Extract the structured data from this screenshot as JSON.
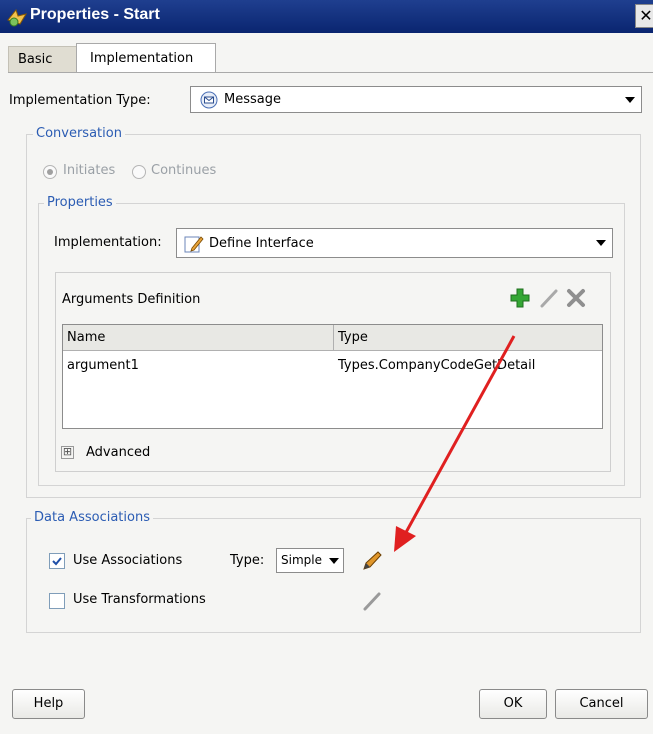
{
  "window": {
    "title": "Properties - Start",
    "close_glyph": "✕"
  },
  "tabs": [
    {
      "label": "Basic",
      "active": false
    },
    {
      "label": "Implementation",
      "active": true
    }
  ],
  "implementation_type": {
    "label": "Implementation Type:",
    "value": "Message",
    "icon": "message-icon"
  },
  "conversation": {
    "legend": "Conversation",
    "options": [
      {
        "label": "Initiates",
        "selected": true
      },
      {
        "label": "Continues",
        "selected": false
      }
    ],
    "properties": {
      "legend": "Properties",
      "implementation_label": "Implementation:",
      "implementation_value": "Define Interface",
      "implementation_icon": "pencil-define-icon",
      "arguments": {
        "title": "Arguments Definition",
        "toolbar_icons": [
          "add-icon",
          "edit-icon",
          "delete-icon"
        ],
        "columns": [
          "Name",
          "Type"
        ],
        "rows": [
          {
            "name": "argument1",
            "type": "Types.CompanyCodeGetDetail"
          }
        ]
      },
      "advanced_label": "Advanced",
      "advanced_expander": "⊞"
    }
  },
  "data_associations": {
    "legend": "Data Associations",
    "use_associations": {
      "label": "Use Associations",
      "checked": true
    },
    "type_label": "Type:",
    "type_value": "Simple",
    "use_transformations": {
      "label": "Use Transformations",
      "checked": false
    }
  },
  "buttons": {
    "help": "Help",
    "ok": "OK",
    "cancel": "Cancel"
  },
  "colors": {
    "titlebar": "#0a2570",
    "accent_blue": "#2b5cb3",
    "annotation_arrow": "#e02020",
    "add_green": "#2ea02e"
  }
}
